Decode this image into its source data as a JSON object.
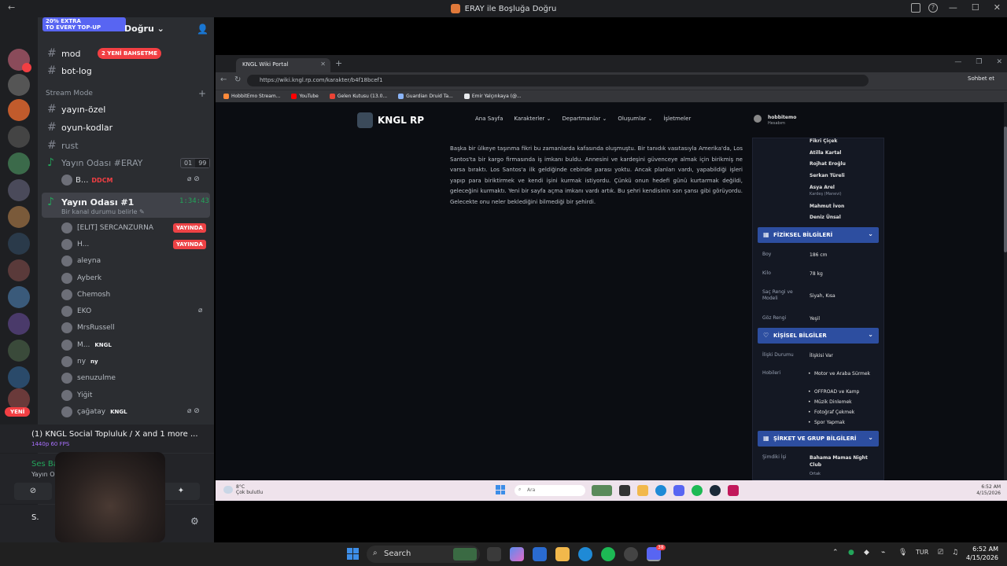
{
  "window": {
    "title": "ERAY ile Boşluğa Doğru"
  },
  "discord": {
    "server_name": "Doğru",
    "promo_line1": "20% EXTRA",
    "promo_line2": "TO EVERY TOP-UP",
    "rail_new": "YENİ",
    "channels_top": [
      {
        "name": "mod",
        "icon": "#"
      },
      {
        "name": "bot-log",
        "icon": "#"
      }
    ],
    "new_mentions": "2 YENİ BAHSETME",
    "section_label": "Stream Mode",
    "channels": [
      "yayın-özel",
      "oyun-kodlar",
      "rust"
    ],
    "voice1": {
      "name": "Yayın Odası #ERAY",
      "count_a": "01",
      "count_b": "99"
    },
    "voice1_member": {
      "name": "B...",
      "tag": "DDCM"
    },
    "voice2": {
      "name": "Yayın Odası #1",
      "timer": "1:34:43",
      "status": "Bir kanal durumu belirle"
    },
    "members": [
      {
        "name": "[ELIT] SERCANZURNA",
        "live": "YAYINDA"
      },
      {
        "name": "H...",
        "live": "YAYINDA"
      },
      {
        "name": "aleyna"
      },
      {
        "name": "Ayberk"
      },
      {
        "name": "Chemosh"
      },
      {
        "name": "EKO"
      },
      {
        "name": "MrsRussell"
      },
      {
        "name": "M...",
        "tag": "KNGL"
      },
      {
        "name": "ny",
        "tag": "ny"
      },
      {
        "name": "senuzulme"
      },
      {
        "name": "Yiğit"
      },
      {
        "name": "çağatay",
        "tag": "KNGL"
      }
    ],
    "stream": {
      "title": "(1) KNGL Social Topluluk / X and 1 more ...",
      "quality": "1440p 60 FPS"
    },
    "voice_status": {
      "title": "Ses Bağlantısı K",
      "sub": "Yayın Odası #1 / ER"
    },
    "user_short": "S."
  },
  "browser": {
    "tab_title": "KNGL Wiki Portal",
    "url": "https://wiki.kngl.rp.com/karakter/b4f18bcef1",
    "sohbet": "Sohbet et",
    "bookmarks": [
      "HobbitEmo Stream...",
      "YouTube",
      "Gelen Kutusu (13.0...",
      "Guardian Druid Ta...",
      "Emir Yalçınkaya (@..."
    ]
  },
  "site": {
    "brand": "KNGL RP",
    "menu": [
      "Ana Sayfa",
      "Karakterler",
      "Departmanlar",
      "Oluşumlar",
      "İşletmeler"
    ],
    "account_name": "hobbitemo",
    "account_role": "Hesabım",
    "story": "Başka bir ülkeye taşınma fikri bu zamanlarda kafasında oluşmuştu. Bir tanıdık vasıtasıyla Amerika'da, Los Santos'ta bir kargo firmasında iş imkanı buldu. Annesini ve kardeşini güvenceye almak için birikmiş ne varsa bıraktı. Los Santos'a ilk geldiğinde cebinde parası yoktu. Ancak planları vardı, yapabildiği işleri yapıp para biriktirmek ve kendi işini kurmak istiyordu. Çünkü onun hedefi günü kurtarmak değildi, geleceğini kurmaktı. Yeni bir sayfa açma imkanı vardı artık. Bu şehri kendisinin son şansı gibi görüyordu. Gelecekte onu neler beklediğini bilmediği bir şehirdi.",
    "relatives": [
      {
        "name": "Fikri Çiçek"
      },
      {
        "name": "Atilla Kartal"
      },
      {
        "name": "Rojhat Eroğlu"
      },
      {
        "name": "Serkan Türeli"
      },
      {
        "name": "Asya Arel",
        "note": "Kardeş (Manevi)"
      },
      {
        "name": "Mahmut İvon"
      },
      {
        "name": "Deniz Ünsal"
      }
    ],
    "physical": {
      "title": "FİZİKSEL BİLGİLERİ",
      "rows": [
        {
          "k": "Boy",
          "v": "186 cm"
        },
        {
          "k": "Kilo",
          "v": "78 kg"
        },
        {
          "k": "Saç Rengi ve Modeli",
          "v": "Siyah, Kısa"
        },
        {
          "k": "Göz Rengi",
          "v": "Yeşil"
        }
      ]
    },
    "personal": {
      "title": "KİŞİSEL BİLGİLER",
      "relationship_k": "İlişki Durumu",
      "relationship_v": "İlişkisi Var",
      "hobbies_k": "Hobileri",
      "hobbies": [
        "Motor ve Araba Sürmek",
        "OFFROAD ve Kamp",
        "Müzik Dinlemek",
        "Fotoğraf Çekmek",
        "Spor Yapmak"
      ]
    },
    "company": {
      "title": "ŞİRKET VE GRUP BİLGİLERİ",
      "current_k": "Şimdiki İşi",
      "current_v": "Bahama Mamas Night Club",
      "role": "Ortak"
    }
  },
  "inner_taskbar": {
    "temp": "8°C",
    "weather": "Çok bulutlu",
    "search": "Ara",
    "time": "6:52 AM",
    "date": "4/15/2026"
  },
  "taskbar": {
    "search": "Search",
    "lang": "TUR",
    "time": "6:52 AM",
    "date": "4/15/2026",
    "discord_badge": "38"
  }
}
